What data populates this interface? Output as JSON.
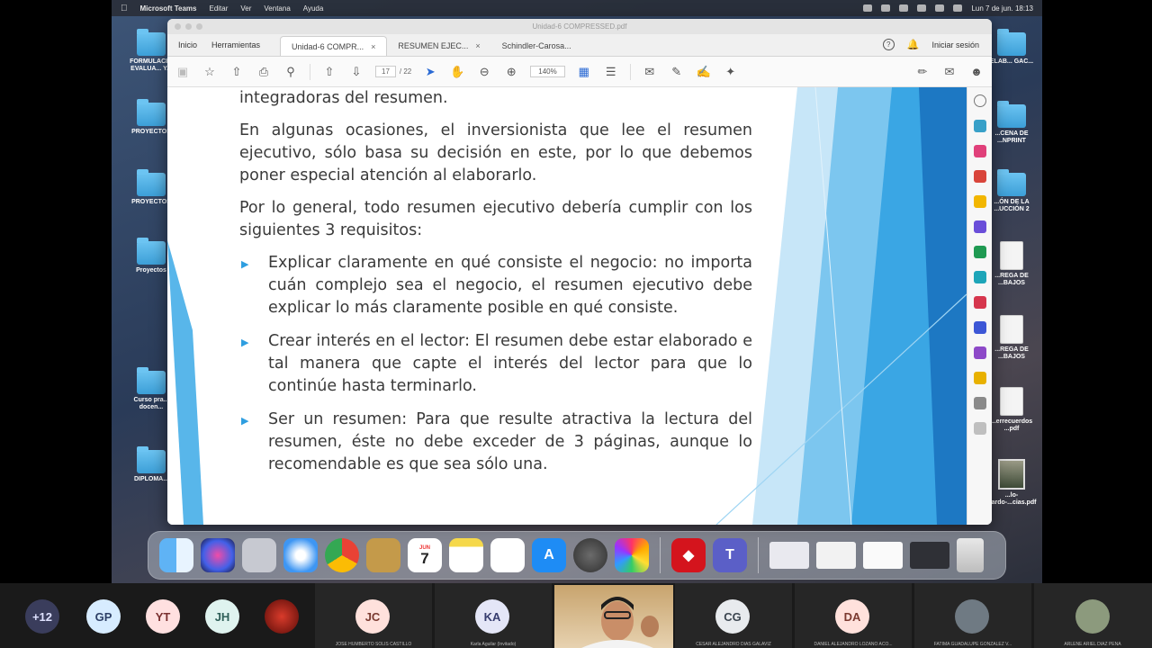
{
  "menubar": {
    "app_name": "Microsoft Teams",
    "menus": [
      "Editar",
      "Ver",
      "Ventana",
      "Ayuda"
    ],
    "clock": "Lun 7 de jun. 18:13"
  },
  "desktop": {
    "left_icons": [
      {
        "label": "FORMULACI... EVALUA... Y..."
      },
      {
        "label": "PROYECTOS"
      },
      {
        "label": "PROYECTOS"
      },
      {
        "label": "Proyectos"
      },
      {
        "label": "Curso pra... docen..."
      },
      {
        "label": "DIPLOMA..."
      }
    ],
    "right_icons": [
      {
        "label": "ELAB... GAC..."
      },
      {
        "label": "...CENA DE ...NPRINT"
      },
      {
        "label": "...ÓN DE LA ...UCCIÓN 2"
      },
      {
        "label": "...REGA DE ...BAJOS"
      },
      {
        "label": "...REGA DE ...BAJOS"
      },
      {
        "label": "...errecuerdos ...pdf"
      },
      {
        "label": "...lo-Cardo-...cias.pdf"
      }
    ]
  },
  "pdf": {
    "window_title": "Unidad-6 COMPRESSED.pdf",
    "nav": [
      "Inicio",
      "Herramientas"
    ],
    "tabs": [
      {
        "label": "Unidad-6 COMPR...",
        "close": "×"
      },
      {
        "label": "RESUMEN EJEC...",
        "close": "×"
      },
      {
        "label": "Schindler-Carosa...",
        "close": ""
      }
    ],
    "help_icon": "?",
    "signin": "Iniciar sesión",
    "page_current": "17",
    "page_total": "/ 22",
    "zoom": "140%",
    "content": {
      "line1": "integradoras del resumen.",
      "para1": "En algunas ocasiones, el inversionista que lee el resumen ejecutivo, sólo basa su decisión en este, por lo que debemos poner especial atención al elaborarlo.",
      "para2": "Por lo general, todo resumen ejecutivo debería cumplir con los siguientes 3 requisitos:",
      "bullets": [
        "Explicar claramente en qué consiste el negocio: no importa cuán complejo sea el negocio, el resumen ejecutivo debe explicar lo más claramente posible en qué consiste.",
        "Crear interés en el lector: El resumen debe estar elaborado e tal manera que capte el interés del lector para que lo continúe hasta terminarlo.",
        "Ser un resumen: Para que resulte atractiva la lectura del resumen, éste no debe exceder de 3 páginas, aunque lo recomendable es que sea sólo una."
      ]
    }
  },
  "dock": {
    "calendar_month": "JUN",
    "calendar_day": "7"
  },
  "participants": {
    "overflow": "+12",
    "small": [
      {
        "initials": "GP",
        "color": "#d7ecff",
        "text_color": "#2d3f66"
      },
      {
        "initials": "YT",
        "color": "#ffe0e0",
        "text_color": "#7a3030"
      },
      {
        "initials": "JH",
        "color": "#dff3ef",
        "text_color": "#2f5f58"
      }
    ],
    "tiles": [
      {
        "initials": "JC",
        "name": "JOSE HUMBERTO SOLIS CASTILLO",
        "color": "#ffe1dc",
        "text_color": "#7a3a30"
      },
      {
        "initials": "KA",
        "name": "Karla Aguilar (Invitado)",
        "color": "#e4e6f7",
        "text_color": "#363c6e"
      },
      {
        "initials": "CG",
        "name": "CESAR ALEJANDRO DIAS GALAVIZ",
        "color": "#e8ebee",
        "text_color": "#3c4650"
      },
      {
        "initials": "DA",
        "name": "DANIEL ALEJANDRO LOZANO ACO...",
        "color": "#ffe1dc",
        "text_color": "#7a3a30"
      },
      {
        "initials": "",
        "name": "FATIMA GUADALUPE GONZALEZ V...",
        "color": "#6f7a83",
        "text_color": "#fff"
      },
      {
        "initials": "",
        "name": "ARLENE ARIEL DIAZ PENA",
        "color": "#8c9a7d",
        "text_color": "#fff"
      }
    ]
  }
}
